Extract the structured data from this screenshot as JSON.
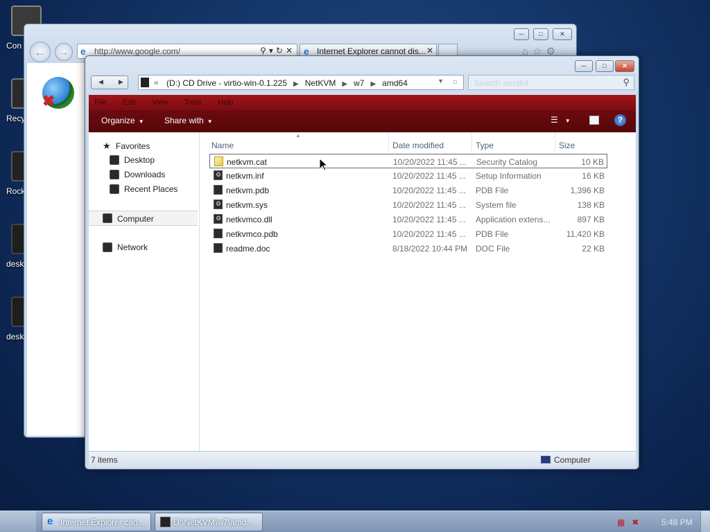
{
  "desktop": {
    "icons": [
      {
        "label": "Con",
        "icon": "computer-icon"
      },
      {
        "label": "Recy",
        "icon": "recycle-bin-icon"
      },
      {
        "label": "Rock",
        "icon": "app-icon"
      },
      {
        "label": "desk",
        "icon": "gear-icon"
      },
      {
        "label": "desk",
        "icon": "gear-icon"
      }
    ]
  },
  "ie": {
    "address": "http://www.google.com/",
    "tab_title": "Internet Explorer cannot dis...",
    "page_icon": "globe-error-icon"
  },
  "explorer": {
    "breadcrumb": {
      "prefix": "«",
      "segments": [
        "(D:) CD Drive - virtio-win-0.1.225",
        "NetKVM",
        "w7",
        "amd64"
      ]
    },
    "search_placeholder": "Search amd64",
    "menubar": [
      "File",
      "Edit",
      "View",
      "Tools",
      "Help"
    ],
    "toolbar": {
      "organize_label": "Organize",
      "share_label": "Share with"
    },
    "nav": {
      "favorites_label": "Favorites",
      "favorites": [
        "Desktop",
        "Downloads",
        "Recent Places"
      ],
      "computer_label": "Computer",
      "network_label": "Network"
    },
    "columns": {
      "name": "Name",
      "date": "Date modified",
      "type": "Type",
      "size": "Size"
    },
    "files": [
      {
        "name": "netkvm.cat",
        "date": "10/20/2022 11:45 ...",
        "type": "Security Catalog",
        "size": "10 KB",
        "icon": "catalog-file-icon"
      },
      {
        "name": "netkvm.inf",
        "date": "10/20/2022 11:45 ...",
        "type": "Setup Information",
        "size": "16 KB",
        "icon": "setup-file-icon"
      },
      {
        "name": "netkvm.pdb",
        "date": "10/20/2022 11:45 ...",
        "type": "PDB File",
        "size": "1,396 KB",
        "icon": "generic-file-icon"
      },
      {
        "name": "netkvm.sys",
        "date": "10/20/2022 11:45 ...",
        "type": "System file",
        "size": "138 KB",
        "icon": "system-file-icon"
      },
      {
        "name": "netkvmco.dll",
        "date": "10/20/2022 11:45 ...",
        "type": "Application extens...",
        "size": "897 KB",
        "icon": "dll-file-icon"
      },
      {
        "name": "netkvmco.pdb",
        "date": "10/20/2022 11:45 ...",
        "type": "PDB File",
        "size": "11,420 KB",
        "icon": "generic-file-icon"
      },
      {
        "name": "readme.doc",
        "date": "8/18/2022 10:44 PM",
        "type": "DOC File",
        "size": "22 KB",
        "icon": "generic-file-icon"
      }
    ],
    "status": {
      "items": "7 items",
      "location": "Computer"
    }
  },
  "taskbar": {
    "buttons": [
      {
        "label": "Internet Explorer can...",
        "icon": "ie-icon"
      },
      {
        "label": "D:\\NetKVM\\w7\\amd...",
        "icon": "explorer-icon"
      }
    ],
    "clock": "5:48 PM"
  },
  "colors": {
    "menubar": "#a3141a",
    "commandbar": "#6d0b10",
    "desktop": "#143668"
  }
}
